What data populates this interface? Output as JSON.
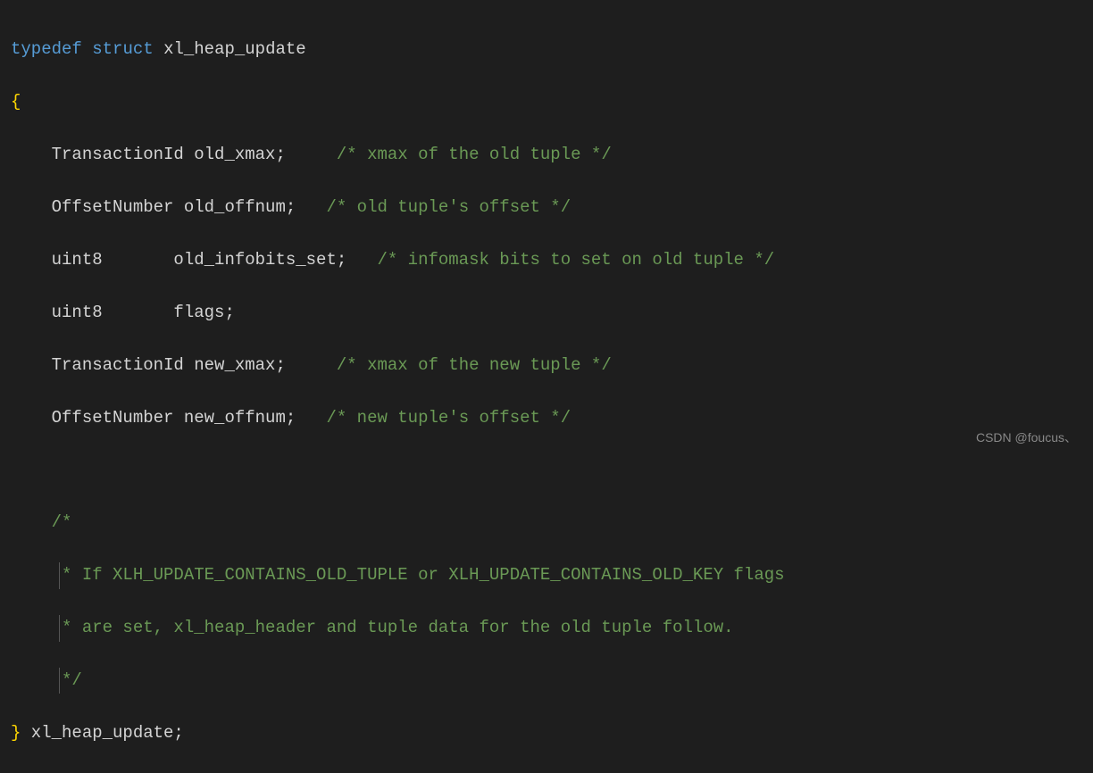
{
  "code": {
    "line1_typedef": "typedef",
    "line1_struct": "struct",
    "line1_name": "xl_heap_update",
    "line2_brace": "{",
    "line3_decl": "    TransactionId old_xmax;",
    "line3_comment": "     /* xmax of the old tuple */",
    "line4_decl": "    OffsetNumber old_offnum;",
    "line4_comment": "   /* old tuple's offset */",
    "line5_decl": "    uint8       old_infobits_set;",
    "line5_comment": "   /* infomask bits to set on old tuple */",
    "line6_decl": "    uint8       flags;",
    "line7_decl": "    TransactionId new_xmax;",
    "line7_comment": "     /* xmax of the new tuple */",
    "line8_decl": "    OffsetNumber new_offnum;",
    "line8_comment": "   /* new tuple's offset */",
    "line10_comment": "    /*",
    "line11_comment": "     * If XLH_UPDATE_CONTAINS_OLD_TUPLE or XLH_UPDATE_CONTAINS_OLD_KEY flags",
    "line12_comment": "     * are set, xl_heap_header and tuple data for the old tuple follow.",
    "line13_comment": "     */",
    "line14_brace": "}",
    "line14_name": " xl_heap_update;"
  },
  "watermark": "CSDN @foucus、"
}
